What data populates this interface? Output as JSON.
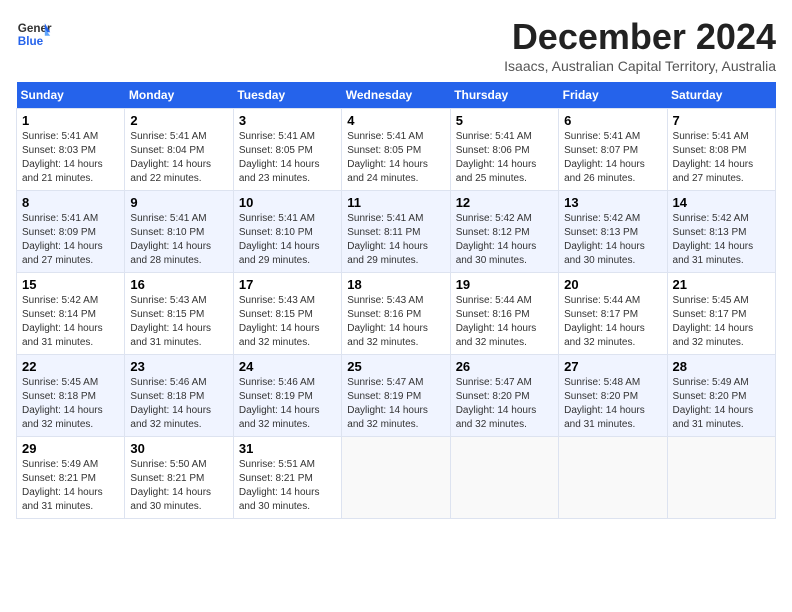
{
  "header": {
    "logo_line1": "General",
    "logo_line2": "Blue",
    "month": "December 2024",
    "location": "Isaacs, Australian Capital Territory, Australia"
  },
  "days_of_week": [
    "Sunday",
    "Monday",
    "Tuesday",
    "Wednesday",
    "Thursday",
    "Friday",
    "Saturday"
  ],
  "weeks": [
    [
      {
        "day": "1",
        "sunrise": "5:41 AM",
        "sunset": "8:03 PM",
        "daylight": "14 hours and 21 minutes."
      },
      {
        "day": "2",
        "sunrise": "5:41 AM",
        "sunset": "8:04 PM",
        "daylight": "14 hours and 22 minutes."
      },
      {
        "day": "3",
        "sunrise": "5:41 AM",
        "sunset": "8:05 PM",
        "daylight": "14 hours and 23 minutes."
      },
      {
        "day": "4",
        "sunrise": "5:41 AM",
        "sunset": "8:05 PM",
        "daylight": "14 hours and 24 minutes."
      },
      {
        "day": "5",
        "sunrise": "5:41 AM",
        "sunset": "8:06 PM",
        "daylight": "14 hours and 25 minutes."
      },
      {
        "day": "6",
        "sunrise": "5:41 AM",
        "sunset": "8:07 PM",
        "daylight": "14 hours and 26 minutes."
      },
      {
        "day": "7",
        "sunrise": "5:41 AM",
        "sunset": "8:08 PM",
        "daylight": "14 hours and 27 minutes."
      }
    ],
    [
      {
        "day": "8",
        "sunrise": "5:41 AM",
        "sunset": "8:09 PM",
        "daylight": "14 hours and 27 minutes."
      },
      {
        "day": "9",
        "sunrise": "5:41 AM",
        "sunset": "8:10 PM",
        "daylight": "14 hours and 28 minutes."
      },
      {
        "day": "10",
        "sunrise": "5:41 AM",
        "sunset": "8:10 PM",
        "daylight": "14 hours and 29 minutes."
      },
      {
        "day": "11",
        "sunrise": "5:41 AM",
        "sunset": "8:11 PM",
        "daylight": "14 hours and 29 minutes."
      },
      {
        "day": "12",
        "sunrise": "5:42 AM",
        "sunset": "8:12 PM",
        "daylight": "14 hours and 30 minutes."
      },
      {
        "day": "13",
        "sunrise": "5:42 AM",
        "sunset": "8:13 PM",
        "daylight": "14 hours and 30 minutes."
      },
      {
        "day": "14",
        "sunrise": "5:42 AM",
        "sunset": "8:13 PM",
        "daylight": "14 hours and 31 minutes."
      }
    ],
    [
      {
        "day": "15",
        "sunrise": "5:42 AM",
        "sunset": "8:14 PM",
        "daylight": "14 hours and 31 minutes."
      },
      {
        "day": "16",
        "sunrise": "5:43 AM",
        "sunset": "8:15 PM",
        "daylight": "14 hours and 31 minutes."
      },
      {
        "day": "17",
        "sunrise": "5:43 AM",
        "sunset": "8:15 PM",
        "daylight": "14 hours and 32 minutes."
      },
      {
        "day": "18",
        "sunrise": "5:43 AM",
        "sunset": "8:16 PM",
        "daylight": "14 hours and 32 minutes."
      },
      {
        "day": "19",
        "sunrise": "5:44 AM",
        "sunset": "8:16 PM",
        "daylight": "14 hours and 32 minutes."
      },
      {
        "day": "20",
        "sunrise": "5:44 AM",
        "sunset": "8:17 PM",
        "daylight": "14 hours and 32 minutes."
      },
      {
        "day": "21",
        "sunrise": "5:45 AM",
        "sunset": "8:17 PM",
        "daylight": "14 hours and 32 minutes."
      }
    ],
    [
      {
        "day": "22",
        "sunrise": "5:45 AM",
        "sunset": "8:18 PM",
        "daylight": "14 hours and 32 minutes."
      },
      {
        "day": "23",
        "sunrise": "5:46 AM",
        "sunset": "8:18 PM",
        "daylight": "14 hours and 32 minutes."
      },
      {
        "day": "24",
        "sunrise": "5:46 AM",
        "sunset": "8:19 PM",
        "daylight": "14 hours and 32 minutes."
      },
      {
        "day": "25",
        "sunrise": "5:47 AM",
        "sunset": "8:19 PM",
        "daylight": "14 hours and 32 minutes."
      },
      {
        "day": "26",
        "sunrise": "5:47 AM",
        "sunset": "8:20 PM",
        "daylight": "14 hours and 32 minutes."
      },
      {
        "day": "27",
        "sunrise": "5:48 AM",
        "sunset": "8:20 PM",
        "daylight": "14 hours and 31 minutes."
      },
      {
        "day": "28",
        "sunrise": "5:49 AM",
        "sunset": "8:20 PM",
        "daylight": "14 hours and 31 minutes."
      }
    ],
    [
      {
        "day": "29",
        "sunrise": "5:49 AM",
        "sunset": "8:21 PM",
        "daylight": "14 hours and 31 minutes."
      },
      {
        "day": "30",
        "sunrise": "5:50 AM",
        "sunset": "8:21 PM",
        "daylight": "14 hours and 30 minutes."
      },
      {
        "day": "31",
        "sunrise": "5:51 AM",
        "sunset": "8:21 PM",
        "daylight": "14 hours and 30 minutes."
      },
      null,
      null,
      null,
      null
    ]
  ]
}
